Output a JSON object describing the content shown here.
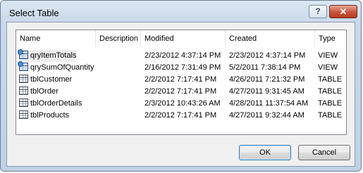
{
  "window": {
    "title": "Select Table",
    "help_label": "?",
    "close_label": "✕"
  },
  "columns": [
    "Name",
    "Description",
    "Modified",
    "Created",
    "Type"
  ],
  "rows": [
    {
      "name": "qryItemTotals",
      "icon": "view-icon",
      "description": "",
      "modified": "2/23/2012 4:37:14 PM",
      "created": "2/23/2012 4:37:14 PM",
      "type": "VIEW",
      "selected": true
    },
    {
      "name": "qrySumOfQuantity",
      "icon": "view-icon",
      "description": "",
      "modified": "2/16/2012 7:31:49 PM",
      "created": "5/2/2011 7:38:14 PM",
      "type": "VIEW"
    },
    {
      "name": "tblCustomer",
      "icon": "table-icon",
      "description": "",
      "modified": "2/2/2012 7:17:41 PM",
      "created": "4/26/2011 7:21:32 PM",
      "type": "TABLE"
    },
    {
      "name": "tblOrder",
      "icon": "table-icon",
      "description": "",
      "modified": "2/2/2012 7:17:41 PM",
      "created": "4/27/2011 9:31:45 AM",
      "type": "TABLE"
    },
    {
      "name": "tblOrderDetails",
      "icon": "table-icon",
      "description": "",
      "modified": "2/3/2012 10:43:26 AM",
      "created": "4/28/2011 11:37:54 AM",
      "type": "TABLE"
    },
    {
      "name": "tblProducts",
      "icon": "table-icon",
      "description": "",
      "modified": "2/2/2012 7:17:41 PM",
      "created": "4/27/2011 9:32:44 AM",
      "type": "TABLE"
    }
  ],
  "buttons": {
    "ok": "OK",
    "cancel": "Cancel"
  }
}
